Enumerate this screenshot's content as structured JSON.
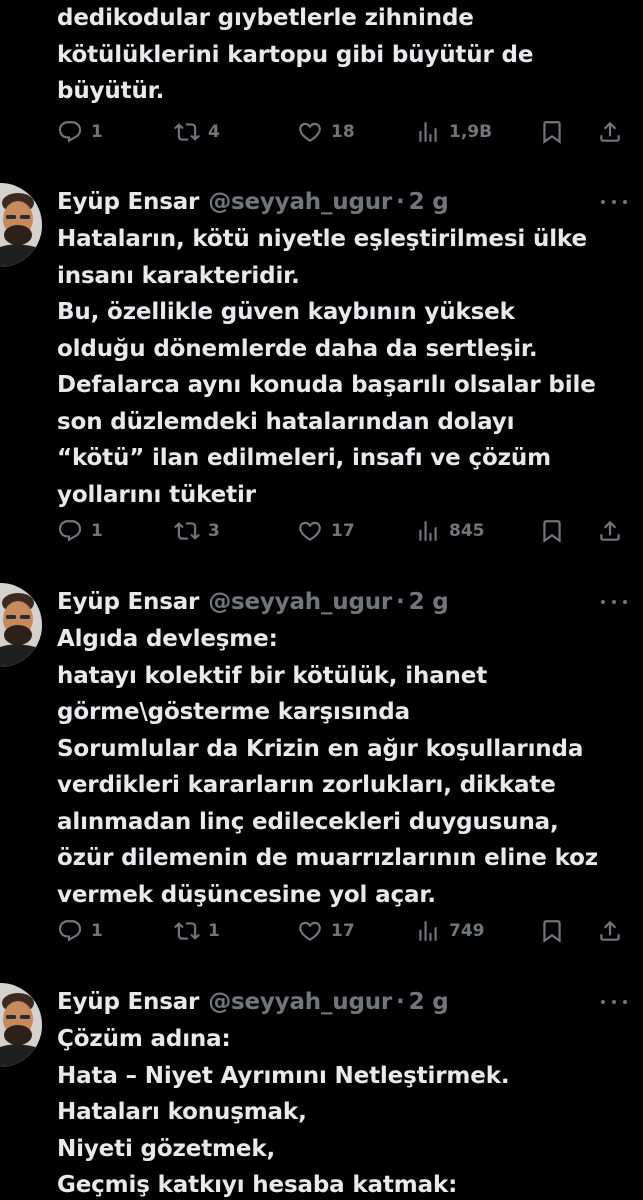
{
  "tweets": [
    {
      "text_lines": [
        "dedikodular gıybetlerle zihninde",
        "kötülüklerini kartopu gibi büyütür de",
        "büyütür."
      ],
      "replies": "1",
      "retweets": "4",
      "likes": "18",
      "views": "1,9B"
    },
    {
      "name": "Eyüp Ensar",
      "handle": "@seyyah_ugur",
      "separator": "·",
      "time": "2 g",
      "text_lines": [
        "Hataların, kötü niyetle eşleştirilmesi ülke",
        "insanı karakteridir.",
        "Bu, özellikle güven kaybının yüksek",
        "olduğu dönemlerde daha da sertleşir.",
        "Defalarca aynı konuda başarılı olsalar bile",
        "son düzlemdeki hatalarından dolayı",
        "“kötü” ilan edilmeleri, insafı ve çözüm",
        "yollarını tüketir"
      ],
      "replies": "1",
      "retweets": "3",
      "likes": "17",
      "views": "845"
    },
    {
      "name": "Eyüp Ensar",
      "handle": "@seyyah_ugur",
      "separator": "·",
      "time": "2 g",
      "text_lines": [
        "Algıda devleşme:",
        "hatayı kolektif bir kötülük, ihanet",
        "görme\\gösterme karşısında",
        "Sorumlular da Krizin en ağır koşullarında",
        "verdikleri kararların zorlukları, dikkate",
        "alınmadan linç edilecekleri duygusuna,",
        "özür dilemenin de muarrızlarının eline koz",
        "vermek düşüncesine yol açar."
      ],
      "replies": "1",
      "retweets": "1",
      "likes": "17",
      "views": "749"
    },
    {
      "name": "Eyüp Ensar",
      "handle": "@seyyah_ugur",
      "separator": "·",
      "time": "2 g",
      "text_lines": [
        "Çözüm adına:",
        "Hata – Niyet Ayrımını Netleştirmek.",
        "Hataları konuşmak,",
        "Niyeti gözetmek,",
        "Geçmiş katkıyı hesaba katmak:"
      ]
    }
  ],
  "icons": {
    "reply": "reply-icon",
    "retweet": "retweet-icon",
    "like": "heart-icon",
    "views": "views-icon",
    "bookmark": "bookmark-icon",
    "share": "share-icon",
    "more": "more-icon"
  },
  "colors": {
    "background": "#000000",
    "text": "#e7e9ea",
    "secondary": "#71767b"
  }
}
